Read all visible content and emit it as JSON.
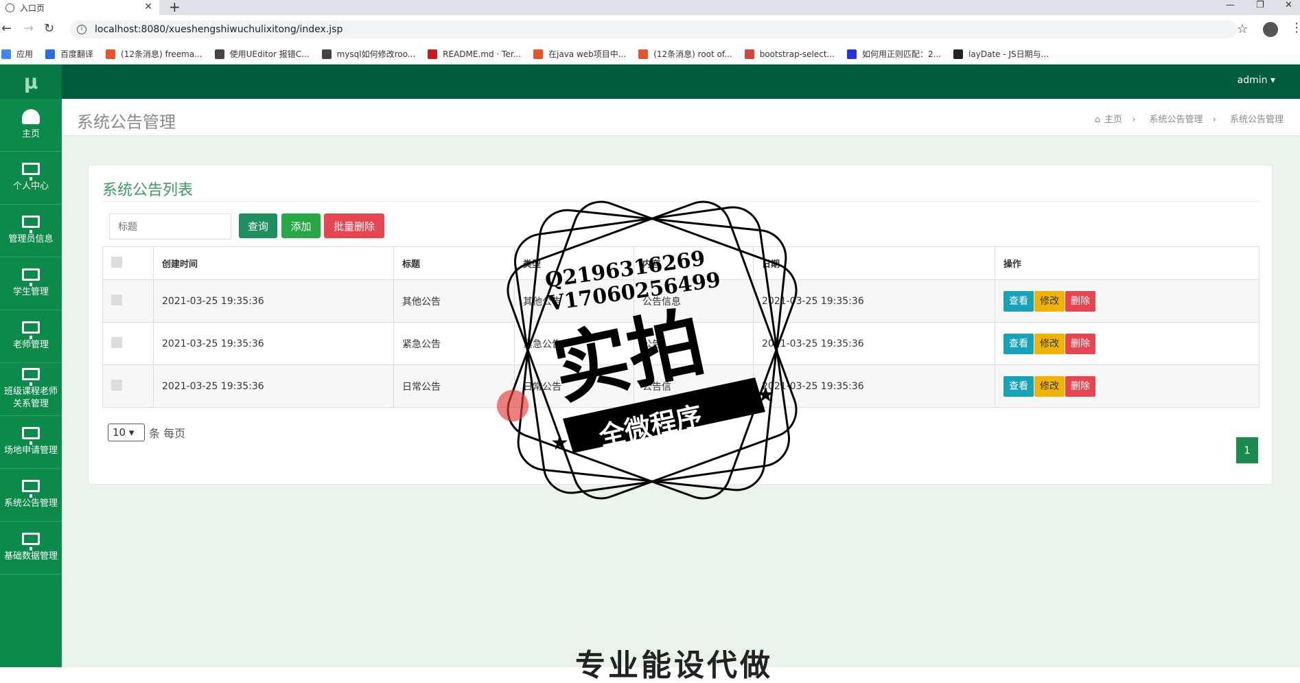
{
  "browser": {
    "tab_title": "入口页",
    "tab_close": "✕",
    "new_tab": "+",
    "url": "localhost:8080/xueshengshiwuchulixitong/index.jsp",
    "bookmarks": [
      {
        "label": "应用",
        "color": "#4285f4"
      },
      {
        "label": "百度翻译",
        "color": "#2b6de0"
      },
      {
        "label": "(12条消息) freema...",
        "color": "#e8542c"
      },
      {
        "label": "使用UEditor 报错C...",
        "color": "#444444"
      },
      {
        "label": "mysql如何修改roo...",
        "color": "#444444"
      },
      {
        "label": "README.md · Ter...",
        "color": "#c7191f"
      },
      {
        "label": "在java web项目中...",
        "color": "#e8542c"
      },
      {
        "label": "(12条消息) root of...",
        "color": "#e8542c"
      },
      {
        "label": "bootstrap-select...",
        "color": "#d2473a"
      },
      {
        "label": "如何用正则匹配：2...",
        "color": "#2932e1"
      },
      {
        "label": "layDate - JS日期与...",
        "color": "#222222"
      }
    ]
  },
  "app": {
    "logo": "μ",
    "user": "admin ▾",
    "sidebar": [
      {
        "label": "主页",
        "icon": "dashboard-icon"
      },
      {
        "label": "个人中心",
        "icon": "monitor-icon"
      },
      {
        "label": "管理员信息",
        "icon": "monitor-icon"
      },
      {
        "label": "学生管理",
        "icon": "monitor-icon"
      },
      {
        "label": "老师管理",
        "icon": "monitor-icon"
      },
      {
        "label": "班级课程老师关系管理",
        "icon": "monitor-icon"
      },
      {
        "label": "场地申请管理",
        "icon": "monitor-icon"
      },
      {
        "label": "系统公告管理",
        "icon": "monitor-icon"
      },
      {
        "label": "基础数据管理",
        "icon": "monitor-icon"
      }
    ],
    "page_title": "系统公告管理",
    "breadcrumb": {
      "home": "主页",
      "sep": "›",
      "level1": "系统公告管理",
      "level2": "系统公告管理"
    },
    "card_title": "系统公告列表",
    "search_placeholder": "标题",
    "buttons": {
      "query": "查询",
      "add": "添加",
      "batch_delete": "批量删除"
    },
    "table": {
      "headers": [
        "创建时间",
        "标题",
        "类型",
        "内容",
        "日期",
        "操作"
      ],
      "rows": [
        {
          "created": "2021-03-25 19:35:36",
          "title": "其他公告",
          "type": "其他公告",
          "content": "公告信息",
          "date": "2021-03-25 19:35:36"
        },
        {
          "created": "2021-03-25 19:35:36",
          "title": "紧急公告",
          "type": "紧急公告",
          "content": "公告",
          "date": "2021-03-25 19:35:36"
        },
        {
          "created": "2021-03-25 19:35:36",
          "title": "日常公告",
          "type": "日常公告",
          "content": "公告信",
          "date": "2021-03-25 19:35:36"
        }
      ],
      "actions": {
        "view": "查看",
        "edit": "修改",
        "delete": "删除"
      }
    },
    "per_page_value": "10 ▾",
    "per_page_label": "条 每页",
    "current_page": "1",
    "colors": {
      "topbar": "#005a3c",
      "sidebar": "#0b8a4a",
      "view": "#17a2b8",
      "edit": "#f0b400",
      "delete": "#e64552",
      "add": "#28a745",
      "query": "#1f8f5f"
    }
  },
  "watermark": {
    "qq": "Q2196316269",
    "vx": "V17060256499",
    "big": "实拍",
    "ribbon": "全微程序"
  },
  "bottom_caption": "专业能设代做"
}
